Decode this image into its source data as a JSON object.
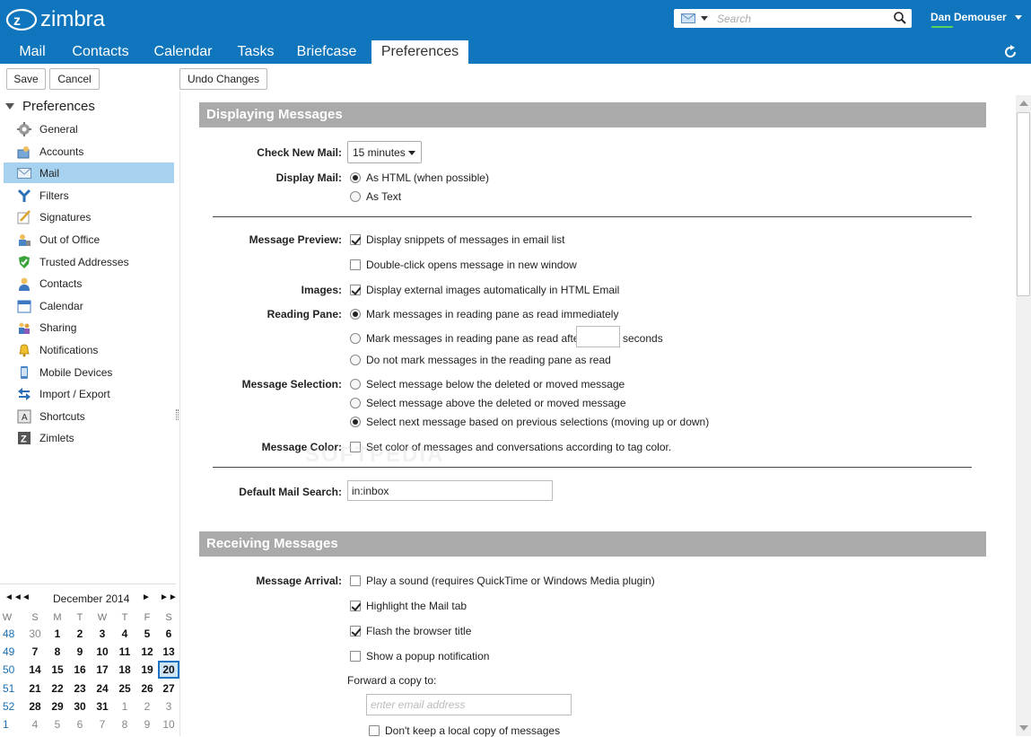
{
  "app": {
    "logo_text": "zimbra",
    "search_placeholder": "Search",
    "user_name": "Dan Demouser",
    "tabs": [
      {
        "label": "Mail"
      },
      {
        "label": "Contacts"
      },
      {
        "label": "Calendar"
      },
      {
        "label": "Tasks"
      },
      {
        "label": "Briefcase"
      },
      {
        "label": "Preferences",
        "active": true
      }
    ]
  },
  "toolbar": {
    "save_label": "Save",
    "cancel_label": "Cancel",
    "undo_label": "Undo Changes"
  },
  "sidebar": {
    "title": "Preferences",
    "items": [
      {
        "label": "General",
        "icon": "gear-icon"
      },
      {
        "label": "Accounts",
        "icon": "accounts-icon"
      },
      {
        "label": "Mail",
        "icon": "envelope-icon",
        "selected": true
      },
      {
        "label": "Filters",
        "icon": "filter-icon"
      },
      {
        "label": "Signatures",
        "icon": "signature-icon"
      },
      {
        "label": "Out of Office",
        "icon": "out-of-office-icon"
      },
      {
        "label": "Trusted Addresses",
        "icon": "shield-check-icon"
      },
      {
        "label": "Contacts",
        "icon": "person-icon"
      },
      {
        "label": "Calendar",
        "icon": "calendar-icon"
      },
      {
        "label": "Sharing",
        "icon": "sharing-icon"
      },
      {
        "label": "Notifications",
        "icon": "bell-icon"
      },
      {
        "label": "Mobile Devices",
        "icon": "mobile-icon"
      },
      {
        "label": "Import / Export",
        "icon": "import-export-icon"
      },
      {
        "label": "Shortcuts",
        "icon": "keyboard-shortcut-icon"
      },
      {
        "label": "Zimlets",
        "icon": "zimlet-icon"
      }
    ]
  },
  "mini_calendar": {
    "month_label": "December 2014",
    "nav": {
      "prev_year": "◄◄",
      "prev_month": "◄",
      "next_month": "►",
      "next_year": "►►"
    },
    "headers": [
      "W",
      "S",
      "M",
      "T",
      "W",
      "T",
      "F",
      "S"
    ],
    "weeks": [
      {
        "week": "48",
        "days": [
          "30",
          "1",
          "2",
          "3",
          "4",
          "5",
          "6"
        ],
        "dim": [
          true,
          false,
          false,
          false,
          false,
          false,
          false
        ]
      },
      {
        "week": "49",
        "days": [
          "7",
          "8",
          "9",
          "10",
          "11",
          "12",
          "13"
        ],
        "dim": [
          false,
          false,
          false,
          false,
          false,
          false,
          false
        ]
      },
      {
        "week": "50",
        "days": [
          "14",
          "15",
          "16",
          "17",
          "18",
          "19",
          "20"
        ],
        "dim": [
          false,
          false,
          false,
          false,
          false,
          false,
          false
        ]
      },
      {
        "week": "51",
        "days": [
          "21",
          "22",
          "23",
          "24",
          "25",
          "26",
          "27"
        ],
        "dim": [
          false,
          false,
          false,
          false,
          false,
          false,
          false
        ]
      },
      {
        "week": "52",
        "days": [
          "28",
          "29",
          "30",
          "31",
          "1",
          "2",
          "3"
        ],
        "dim": [
          false,
          false,
          false,
          false,
          true,
          true,
          true
        ]
      },
      {
        "week": "1",
        "days": [
          "4",
          "5",
          "6",
          "7",
          "8",
          "9",
          "10"
        ],
        "dim": [
          true,
          true,
          true,
          true,
          true,
          true,
          true
        ]
      }
    ],
    "today": "20"
  },
  "displaying": {
    "header": "Displaying Messages",
    "check_new_mail_label": "Check New Mail:",
    "check_new_mail_value": "15 minutes",
    "display_mail_label": "Display Mail:",
    "display_mail_options": [
      "As HTML (when possible)",
      "As Text"
    ],
    "message_preview_label": "Message Preview:",
    "snippets": "Display snippets of messages in email list",
    "double_click": "Double-click opens message in new window",
    "images_label": "Images:",
    "images_option": "Display external images automatically in HTML Email",
    "reading_pane_label": "Reading Pane:",
    "reading_pane_options": [
      "Mark messages in reading pane as read immediately",
      "Mark messages in reading pane as read after",
      "Do not mark messages in the reading pane as read"
    ],
    "seconds_label": "seconds",
    "message_selection_label": "Message Selection:",
    "message_selection_options": [
      "Select message below the deleted or moved message",
      "Select message above the deleted or moved message",
      "Select next message based on previous selections (moving up or down)"
    ],
    "message_color_label": "Message Color:",
    "message_color_option": "Set color of messages and conversations according to tag color.",
    "default_search_label": "Default Mail Search:",
    "default_search_value": "in:inbox"
  },
  "receiving": {
    "header": "Receiving Messages",
    "message_arrival_label": "Message Arrival:",
    "options": [
      "Play a sound (requires QuickTime or Windows Media plugin)",
      "Highlight the Mail tab",
      "Flash the browser title",
      "Show a popup notification"
    ],
    "forward_label": "Forward a copy to:",
    "forward_placeholder": "enter email address",
    "dont_keep_label": "Don't keep a local copy of messages"
  },
  "watermark": "SOFTPEDIA"
}
